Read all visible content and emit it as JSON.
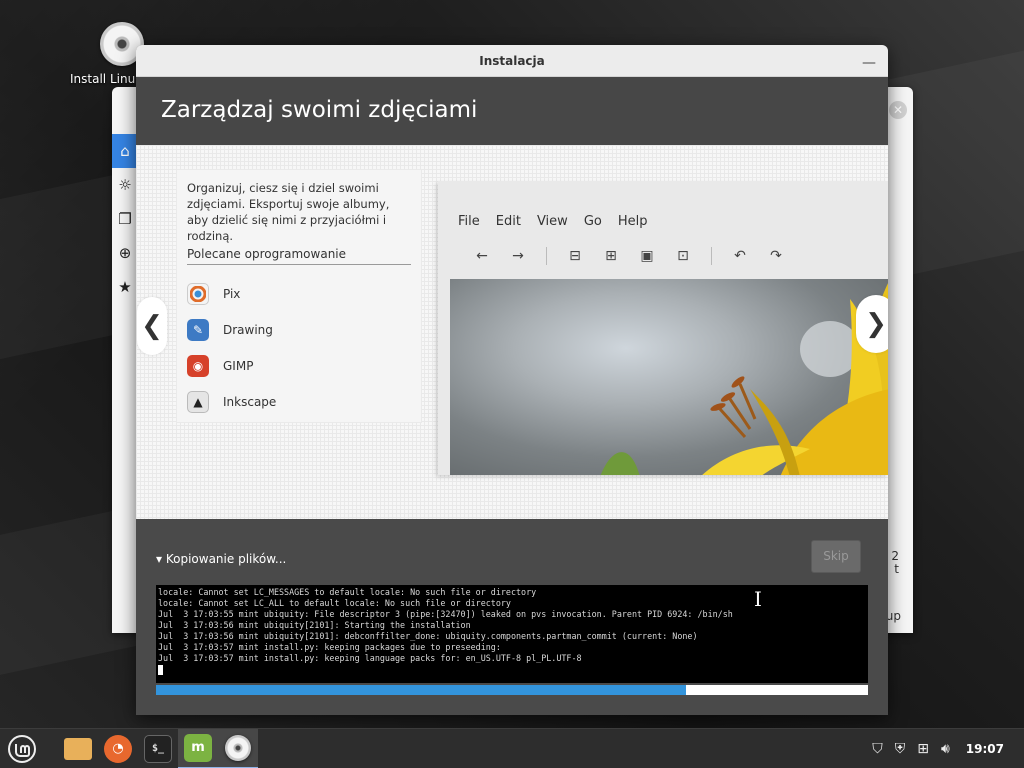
{
  "desktop": {
    "icon_label": "Install Linu"
  },
  "background_window": {
    "peek_right_top": "2",
    "peek_right_mid": "t",
    "peek_right_bottom": "up"
  },
  "window": {
    "title": "Instalacja",
    "minimize_glyph": "—"
  },
  "header": {
    "title": "Zarządzaj swoimi zdjęciami"
  },
  "slide": {
    "description": "Organizuj, ciesz się i dziel swoimi zdjęciami. Eksportuj swoje albumy, aby dzielić się nimi z przyjaciółmi i rodziną.",
    "subheading": "Polecane oprogramowanie",
    "apps": [
      {
        "label": "Pix"
      },
      {
        "label": "Drawing"
      },
      {
        "label": "GIMP"
      },
      {
        "label": "Inkscape"
      }
    ],
    "prev_glyph": "❮",
    "next_glyph": "❯",
    "screenshot_menu": [
      "File",
      "Edit",
      "View",
      "Go",
      "Help"
    ]
  },
  "progress": {
    "label": "Kopiowanie plików...",
    "skip_label": "Skip",
    "fraction": 0.745
  },
  "terminal": {
    "lines": [
      "locale: Cannot set LC_MESSAGES to default locale: No such file or directory",
      "locale: Cannot set LC_ALL to default locale: No such file or directory",
      "Jul  3 17:03:55 mint ubiquity: File descriptor 3 (pipe:[32470]) leaked on pvs invocation. Parent PID 6924: /bin/sh",
      "Jul  3 17:03:56 mint ubiquity[2101]: Starting the installation",
      "Jul  3 17:03:56 mint ubiquity[2101]: debconffilter_done: ubiquity.components.partman_commit (current: None)",
      "Jul  3 17:03:57 mint install.py: keeping packages due to preseeding:",
      "Jul  3 17:03:57 mint install.py: keeping language packs for: en_US.UTF-8 pl_PL.UTF-8"
    ]
  },
  "taskbar": {
    "clock": "19:07",
    "terminal_glyph": "$_"
  }
}
